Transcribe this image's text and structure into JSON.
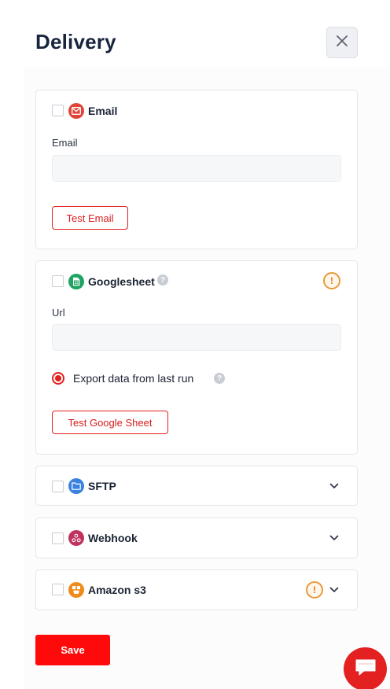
{
  "header": {
    "title": "Delivery"
  },
  "email": {
    "label": "Email",
    "field_label": "Email",
    "value": "",
    "test_button": "Test Email"
  },
  "googlesheet": {
    "label": "Googlesheet",
    "field_label": "Url",
    "value": "",
    "export_option": "Export data from last run",
    "test_button": "Test Google Sheet",
    "warning": "!"
  },
  "sftp": {
    "label": "SFTP"
  },
  "webhook": {
    "label": "Webhook"
  },
  "amazon": {
    "label": "Amazon s3",
    "warning": "!"
  },
  "help_glyph": "?",
  "footer": {
    "save_label": "Save"
  },
  "colors": {
    "accent": "#e51d1d",
    "save": "#ff0a0a",
    "email_icon": "#e0453a",
    "sheet_icon": "#1fa463",
    "sftp_icon": "#3b82e0",
    "webhook_icon": "#c0335e",
    "s3_icon": "#ef8b1a",
    "warning": "#e89a3c"
  },
  "icons": [
    "close-icon",
    "mail-icon",
    "sheet-icon",
    "folder-icon",
    "webhook-icon",
    "s3-bucket-icon",
    "help-icon",
    "warning-icon",
    "chevron-down-icon",
    "chat-icon"
  ]
}
